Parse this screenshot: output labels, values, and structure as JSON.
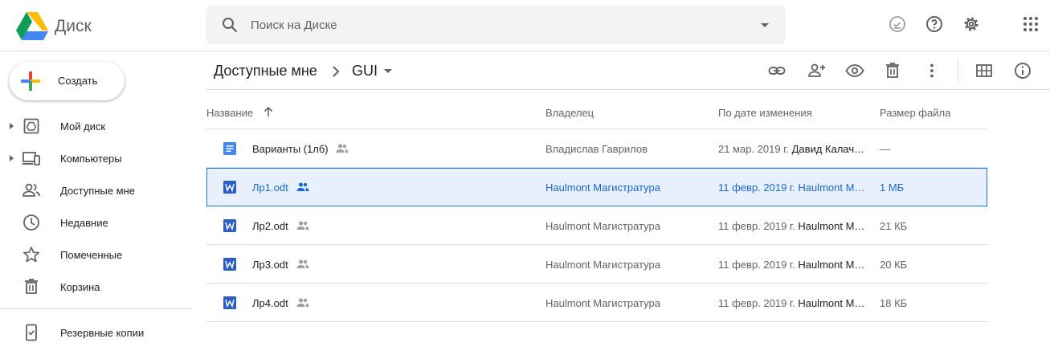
{
  "header": {
    "app_title": "Диск",
    "search_placeholder": "Поиск на Диске",
    "icons": [
      "offline-icon",
      "help-icon",
      "settings-icon",
      "apps-icon"
    ]
  },
  "sidebar": {
    "create_label": "Создать",
    "items": [
      {
        "label": "Мой диск",
        "icon": "my-drive-icon",
        "expandable": true
      },
      {
        "label": "Компьютеры",
        "icon": "computers-icon",
        "expandable": true
      },
      {
        "label": "Доступные мне",
        "icon": "shared-with-me-icon",
        "expandable": false
      },
      {
        "label": "Недавние",
        "icon": "recent-icon",
        "expandable": false
      },
      {
        "label": "Помеченные",
        "icon": "star-icon",
        "expandable": false
      },
      {
        "label": "Корзина",
        "icon": "trash-icon",
        "expandable": false
      },
      {
        "label": "Резервные копии",
        "icon": "backups-icon",
        "expandable": false
      }
    ]
  },
  "toolbar": {
    "breadcrumb_root": "Доступные мне",
    "breadcrumb_current": "GUI",
    "icons": [
      "link-icon",
      "share-icon",
      "preview-icon",
      "delete-icon",
      "more-icon",
      "grid-view-icon",
      "info-icon"
    ]
  },
  "table": {
    "columns": {
      "name": "Название",
      "owner": "Владелец",
      "modified": "По дате изменения",
      "size": "Размер файла"
    },
    "rows": [
      {
        "name": "Варианты (1лб)",
        "type": "document",
        "shared": true,
        "owner": "Владислав Гаврилов",
        "modified_date": "21 мар. 2019 г.",
        "modified_by": "Давид Калач…",
        "size": "—",
        "selected": false
      },
      {
        "name": "Лр1.odt",
        "type": "word",
        "shared": true,
        "owner": "Haulmont Магистратура",
        "modified_date": "11 февр. 2019 г.",
        "modified_by": "Haulmont M…",
        "size": "1 МБ",
        "selected": true
      },
      {
        "name": "Лр2.odt",
        "type": "word",
        "shared": true,
        "owner": "Haulmont Магистратура",
        "modified_date": "11 февр. 2019 г.",
        "modified_by": "Haulmont M…",
        "size": "21 КБ",
        "selected": false
      },
      {
        "name": "Лр3.odt",
        "type": "word",
        "shared": true,
        "owner": "Haulmont Магистратура",
        "modified_date": "11 февр. 2019 г.",
        "modified_by": "Haulmont M…",
        "size": "20 КБ",
        "selected": false
      },
      {
        "name": "Лр4.odt",
        "type": "word",
        "shared": true,
        "owner": "Haulmont Магистратура",
        "modified_date": "11 февр. 2019 г.",
        "modified_by": "Haulmont M…",
        "size": "18 КБ",
        "selected": false
      }
    ]
  },
  "colors": {
    "accent": "#1a73e8",
    "selected_bg": "#e8f0fe",
    "selected_text": "#1967d2",
    "doc_blue": "#4285f4",
    "word_blue": "#2b5fc7",
    "icon_gray": "#5f6368",
    "divider": "#dadce0",
    "search_bg": "#f1f3f4"
  }
}
